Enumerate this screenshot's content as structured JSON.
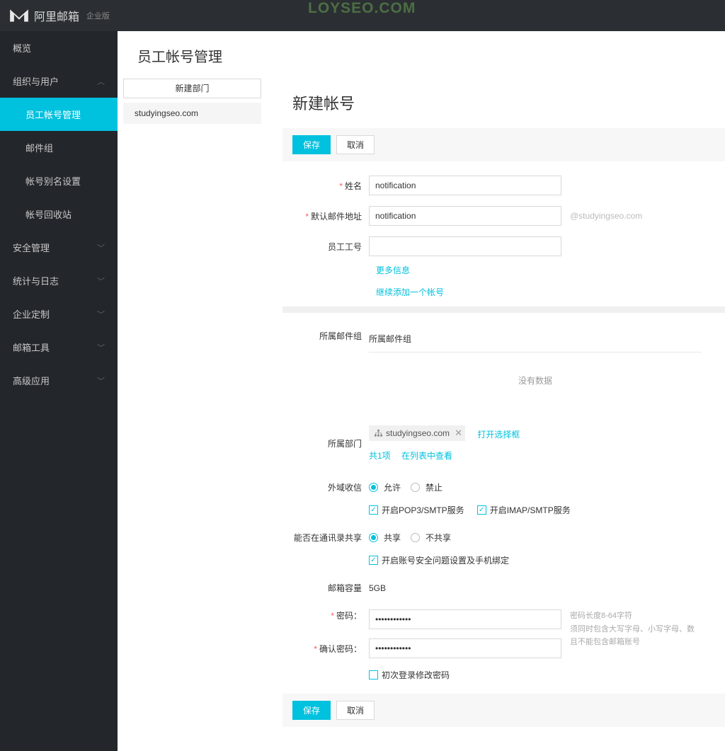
{
  "header": {
    "brand": "阿里邮箱",
    "brand_sub": "企业版",
    "watermark": "LOYSEO.COM"
  },
  "sidebar": {
    "overview": "概览",
    "org_users": "组织与用户",
    "account_mgmt": "员工帐号管理",
    "mail_group": "邮件组",
    "alias": "帐号别名设置",
    "recycle": "帐号回收站",
    "security": "安全管理",
    "stats": "统计与日志",
    "customize": "企业定制",
    "mail_tools": "邮箱工具",
    "advanced": "高级应用"
  },
  "page": {
    "title": "员工帐号管理",
    "new_dept": "新建部门",
    "dept_name": "studyingseo.com",
    "panel_title": "新建帐号",
    "save": "保存",
    "cancel": "取消"
  },
  "form": {
    "name_label": "姓名",
    "name_value": "notification",
    "email_label": "默认邮件地址",
    "email_value": "notification",
    "email_domain": "@studyingseo.com",
    "empno_label": "员工工号",
    "more_info": "更多信息",
    "add_another": "继续添加一个帐号",
    "mailgroup_label": "所属邮件组",
    "mailgroup_value": "所属邮件组",
    "no_data": "没有数据",
    "dept_label": "所属部门",
    "dept_tag": "studyingseo.com",
    "open_selector": "打开选择框",
    "count_text": "共1项",
    "view_list": "在列表中查看",
    "ext_recv_label": "外域收信",
    "allow": "允许",
    "forbid": "禁止",
    "pop3_label": "开启POP3/SMTP服务",
    "imap_label": "开启IMAP/SMTP服务",
    "share_label": "能否在通讯录共享",
    "share_yes": "共享",
    "share_no": "不共享",
    "security_q": "开启账号安全问题设置及手机绑定",
    "capacity_label": "邮箱容量",
    "capacity_value": "5GB",
    "pw_label": "密码：",
    "pw_confirm_label": "确认密码：",
    "pw_value": "••••••••••••",
    "pw_hint1": "密码长度8-64字符",
    "pw_hint2": "须同时包含大写字母、小写字母、数",
    "pw_hint3": "且不能包含邮箱账号",
    "first_login": "初次登录修改密码"
  }
}
